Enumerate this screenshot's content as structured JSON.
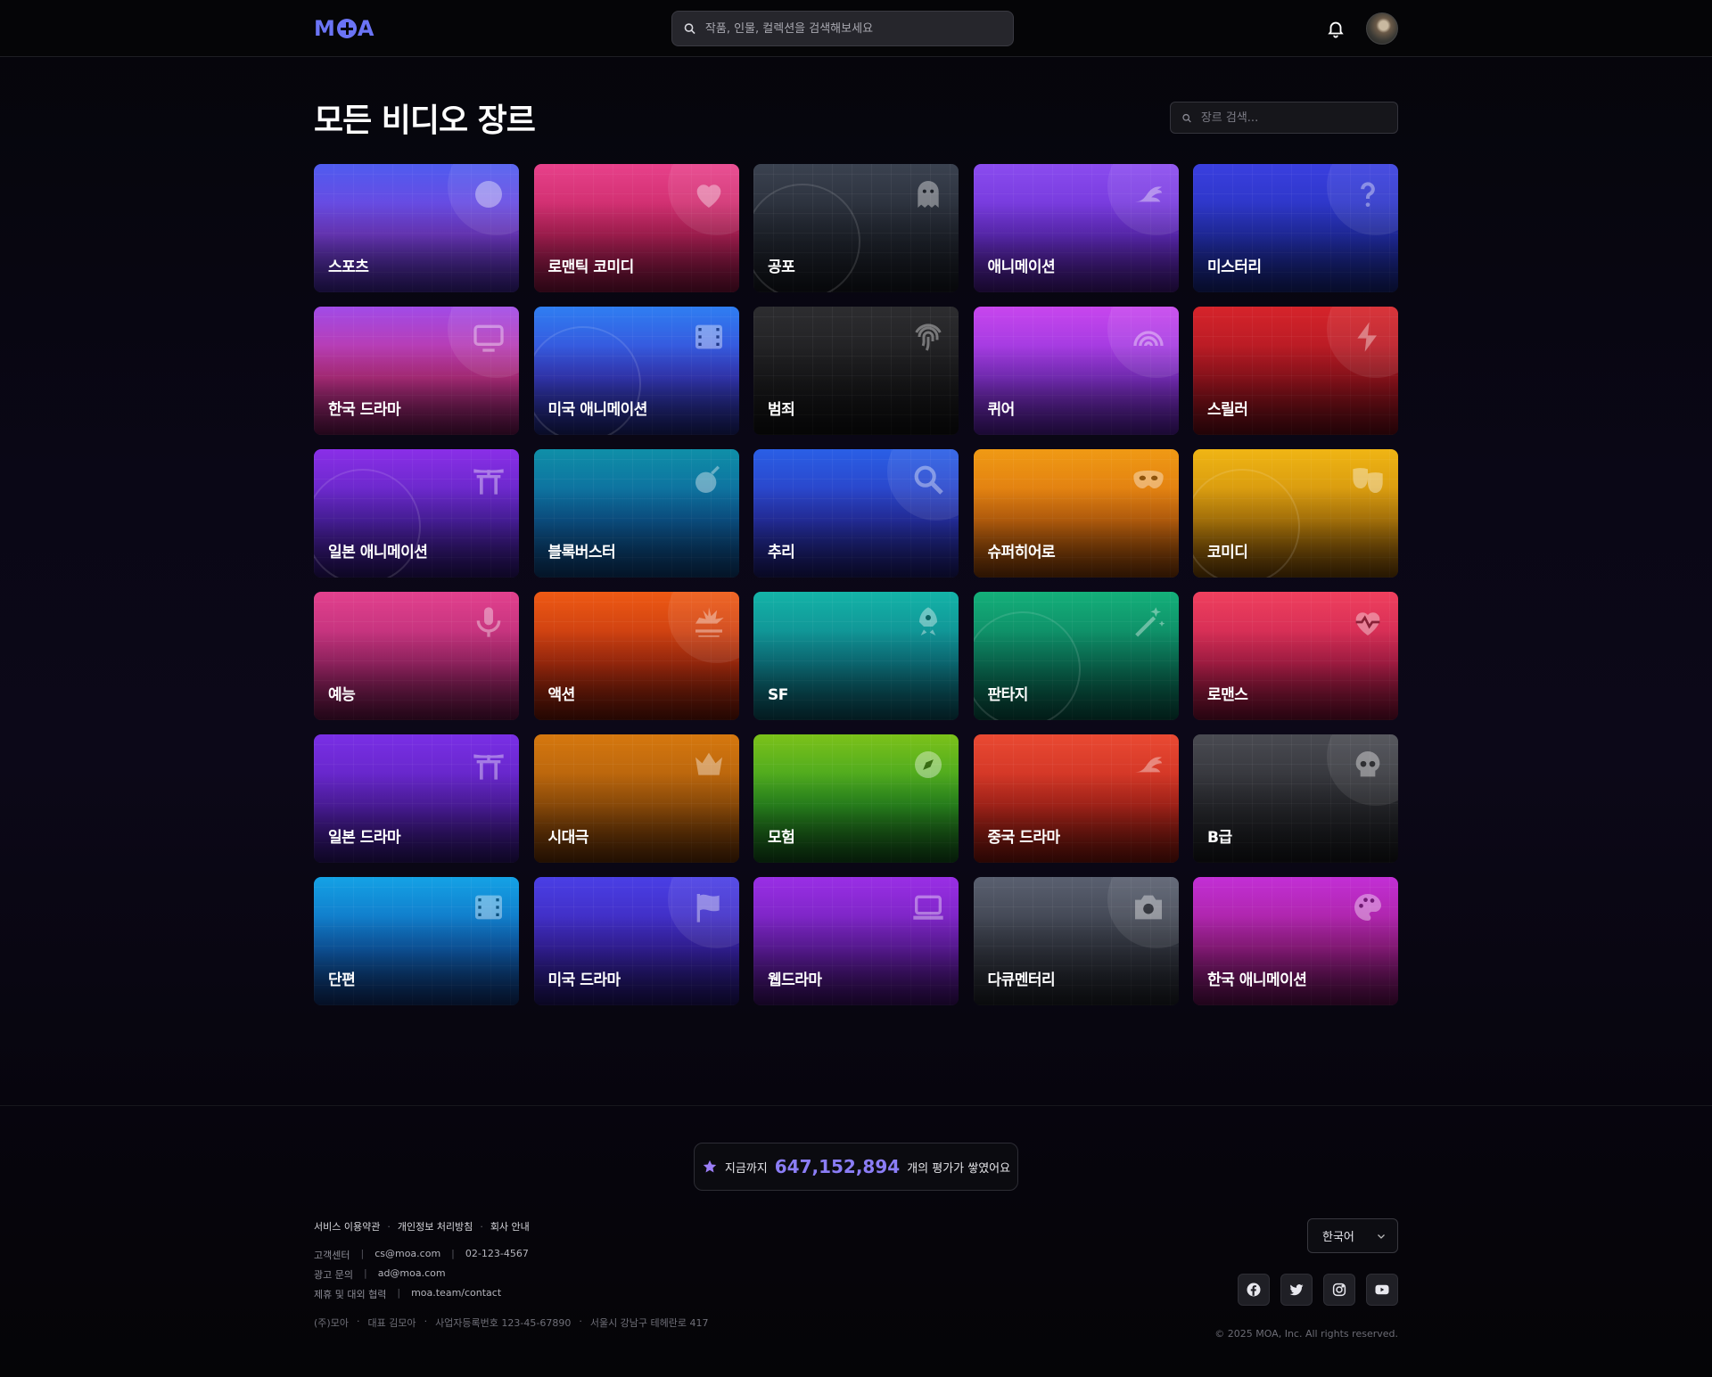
{
  "header": {
    "logo_text": "MOA",
    "search_placeholder": "작품, 인물, 컬렉션을 검색해보세요"
  },
  "main": {
    "title": "모든 비디오 장르",
    "genre_search_placeholder": "장르 검색..."
  },
  "genres": [
    {
      "label": "스포츠",
      "icon": "basketball-icon",
      "colors": [
        "#4f5cf0",
        "#7a3fd8",
        "#2c1a6e"
      ]
    },
    {
      "label": "로맨틱 코미디",
      "icon": "heart-icon",
      "colors": [
        "#e8418b",
        "#c0235e",
        "#5c0d2c"
      ]
    },
    {
      "label": "공포",
      "icon": "ghost-icon",
      "colors": [
        "#3b4250",
        "#222731",
        "#0f1117"
      ]
    },
    {
      "label": "애니메이션",
      "icon": "dragon-icon",
      "colors": [
        "#8b4cf0",
        "#6a2fd0",
        "#31115e"
      ]
    },
    {
      "label": "미스터리",
      "icon": "question-icon",
      "colors": [
        "#3a3fe0",
        "#2531b8",
        "#0f1a5a"
      ]
    },
    {
      "label": "한국 드라마",
      "icon": "tv-icon",
      "colors": [
        "#a14be8",
        "#c8338e",
        "#4a0f3a"
      ]
    },
    {
      "label": "미국 애니메이션",
      "icon": "film-icon",
      "colors": [
        "#2f7ef2",
        "#3b3fd0",
        "#141a55"
      ]
    },
    {
      "label": "범죄",
      "icon": "fingerprint-icon",
      "colors": [
        "#2d2d30",
        "#1b1b1d",
        "#0b0b0c"
      ]
    },
    {
      "label": "퀴어",
      "icon": "rainbow-icon",
      "colors": [
        "#c846ee",
        "#8b34d8",
        "#3a1470"
      ]
    },
    {
      "label": "스릴러",
      "icon": "bolt-icon",
      "colors": [
        "#d6242b",
        "#a51520",
        "#4a0810"
      ]
    },
    {
      "label": "일본 애니메이션",
      "icon": "torii-icon",
      "colors": [
        "#8a2fe8",
        "#5624b8",
        "#1e0e4f"
      ]
    },
    {
      "label": "블록버스터",
      "icon": "bomb-icon",
      "colors": [
        "#0f8fa8",
        "#0d5e9a",
        "#082c55"
      ]
    },
    {
      "label": "추리",
      "icon": "magnifier-icon",
      "colors": [
        "#2a5fe6",
        "#2a35b8",
        "#13124c"
      ]
    },
    {
      "label": "슈퍼히어로",
      "icon": "mask-icon",
      "colors": [
        "#f09a14",
        "#d9700f",
        "#5e2a05"
      ]
    },
    {
      "label": "코미디",
      "icon": "theater-masks-icon",
      "colors": [
        "#f0b514",
        "#c98a0c",
        "#553205"
      ]
    },
    {
      "label": "예능",
      "icon": "microphone-icon",
      "colors": [
        "#e3418e",
        "#b02a73",
        "#4a0e33"
      ]
    },
    {
      "label": "액션",
      "icon": "explosion-icon",
      "colors": [
        "#ef5a14",
        "#b8300f",
        "#4f0f05"
      ]
    },
    {
      "label": "SF",
      "icon": "rocket-icon",
      "colors": [
        "#14b4a8",
        "#0e7f8a",
        "#073a45"
      ]
    },
    {
      "label": "판타지",
      "icon": "magic-wand-icon",
      "colors": [
        "#14b07a",
        "#0b7a5c",
        "#053d33"
      ]
    },
    {
      "label": "로맨스",
      "icon": "heartbeat-icon",
      "colors": [
        "#f0405e",
        "#c42250",
        "#560a24"
      ]
    },
    {
      "label": "일본 드라마",
      "icon": "torii-icon",
      "colors": [
        "#7a2fe6",
        "#5a21b8",
        "#1f0e4f"
      ]
    },
    {
      "label": "시대극",
      "icon": "crown-icon",
      "colors": [
        "#d6780f",
        "#a85a0b",
        "#4a2204"
      ]
    },
    {
      "label": "모험",
      "icon": "compass-icon",
      "colors": [
        "#7cc21a",
        "#2f9a22",
        "#0c3a13"
      ]
    },
    {
      "label": "중국 드라마",
      "icon": "dragon-icon",
      "colors": [
        "#ea4a33",
        "#c42a1e",
        "#5a0e08"
      ]
    },
    {
      "label": "B급",
      "icon": "skull-icon",
      "colors": [
        "#4a4b52",
        "#2a2b30",
        "#101114"
      ]
    },
    {
      "label": "단편",
      "icon": "film-icon",
      "colors": [
        "#14a2e6",
        "#0f64b8",
        "#0a214f"
      ]
    },
    {
      "label": "미국 드라마",
      "icon": "flag-icon",
      "colors": [
        "#4a3fe6",
        "#3b24b0",
        "#160e4a"
      ]
    },
    {
      "label": "웹드라마",
      "icon": "laptop-icon",
      "colors": [
        "#9a2fe6",
        "#6a1fb0",
        "#2b0a4a"
      ]
    },
    {
      "label": "다큐멘터리",
      "icon": "camera-icon",
      "colors": [
        "#5a6070",
        "#353944",
        "#15171c"
      ]
    },
    {
      "label": "한국 애니메이션",
      "icon": "palette-icon",
      "colors": [
        "#c32fd6",
        "#a01f8f",
        "#450a3a"
      ]
    }
  ],
  "footer": {
    "ratings": {
      "prefix": "지금까지",
      "count": "647,152,894",
      "suffix": "개의 평가가 쌓였어요"
    },
    "links": [
      "서비스 이용약관",
      "개인정보 처리방침",
      "회사 안내"
    ],
    "contacts": [
      {
        "label": "고객센터",
        "values": [
          "cs@moa.com",
          "02-123-4567"
        ]
      },
      {
        "label": "광고 문의",
        "values": [
          "ad@moa.com"
        ]
      },
      {
        "label": "제휴 및 대외 협력",
        "values": [
          "moa.team/contact"
        ]
      }
    ],
    "company": [
      "(주)모아",
      "대표 김모아",
      "사업자등록번호 123-45-67890",
      "서울시 강남구 테헤란로 417"
    ],
    "language": "한국어",
    "socials": [
      "facebook-icon",
      "twitter-icon",
      "instagram-icon",
      "youtube-icon"
    ],
    "copyright": "© 2025 MOA, Inc. All rights reserved."
  }
}
